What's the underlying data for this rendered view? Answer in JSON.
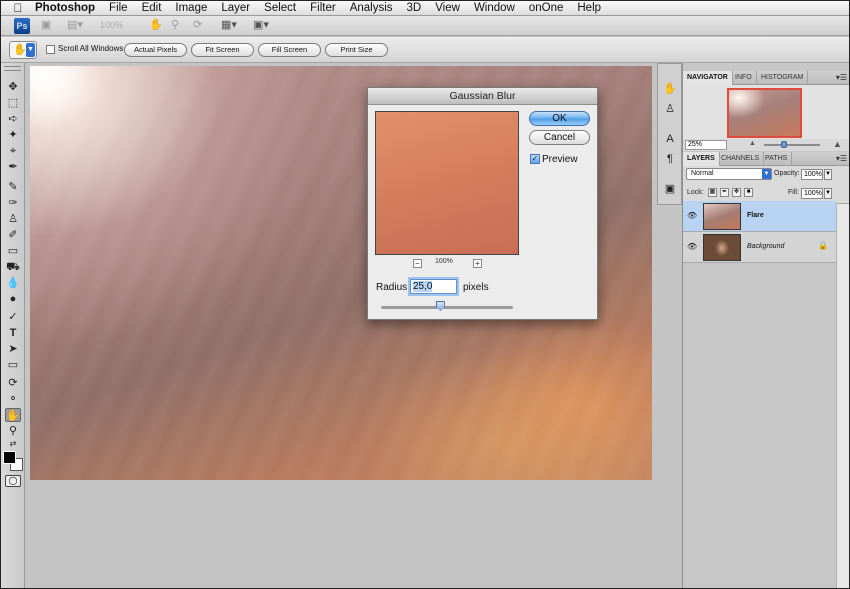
{
  "menubar": {
    "apple_icon": "apple-icon",
    "app_name": "Photoshop",
    "items": [
      "File",
      "Edit",
      "Image",
      "Layer",
      "Select",
      "Filter",
      "Analysis",
      "3D",
      "View",
      "Window",
      "onOne",
      "Help"
    ]
  },
  "appbar": {
    "logo": "Ps",
    "zoom": "100%"
  },
  "options": {
    "tool_icon": "hand-icon",
    "scroll_all_windows": "Scroll All Windows",
    "scroll_all_checked": false,
    "buttons": [
      "Actual Pixels",
      "Fit Screen",
      "Fill Screen",
      "Print Size"
    ]
  },
  "dialog": {
    "title": "Gaussian Blur",
    "ok": "OK",
    "cancel": "Cancel",
    "preview_label": "Preview",
    "preview_checked": true,
    "zoom_out": "−",
    "zoom_in": "+",
    "zoom_value": "100%",
    "radius_label": "Radius:",
    "radius_value": "25,0",
    "radius_unit": "pixels",
    "slider_fraction": 0.45
  },
  "navigator": {
    "tabs": [
      "NAVIGATOR",
      "INFO",
      "HISTOGRAM"
    ],
    "active_tab": "NAVIGATOR",
    "zoom": "25%"
  },
  "layers_panel": {
    "tabs": [
      "LAYERS",
      "CHANNELS",
      "PATHS"
    ],
    "active_tab": "LAYERS",
    "blend_mode": "Normal",
    "opacity_label": "Opacity:",
    "opacity_value": "100%",
    "lock_label": "Lock:",
    "fill_label": "Fill:",
    "fill_value": "100%",
    "layers": [
      {
        "name": "Flare",
        "selected": true
      },
      {
        "name": "Background",
        "selected": false,
        "locked": true
      }
    ]
  },
  "colors": {
    "foreground": "#000000",
    "background": "#ffffff",
    "selection": "#b7d3f1",
    "accent": "#4f9be8"
  }
}
